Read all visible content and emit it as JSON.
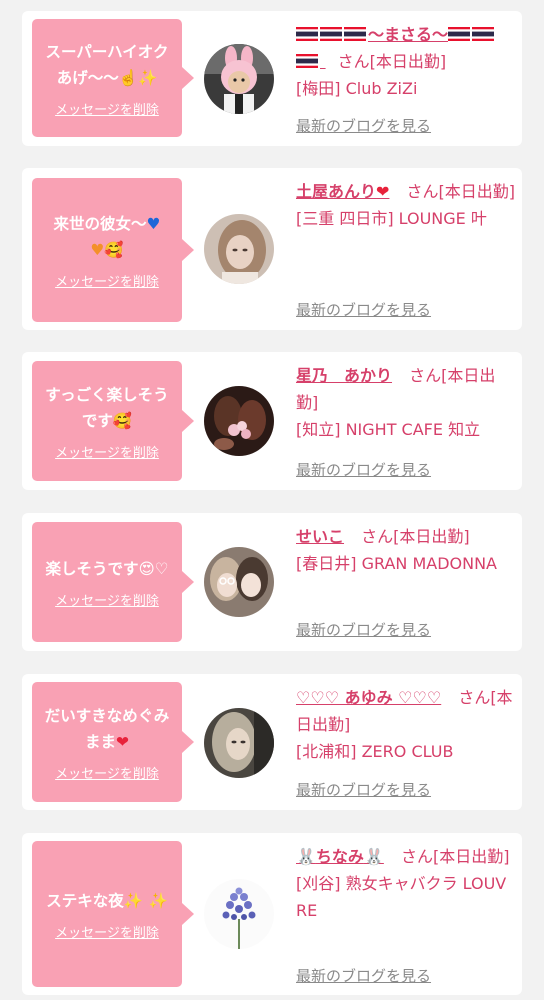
{
  "cards": [
    {
      "message": "スーパーハイオクあげ〜〜☝️✨",
      "delete_label": "メッセージを削除",
      "name": "〜まさる〜",
      "suffix": "さん[本日出勤]",
      "shop": "[梅田] Club ZiZi",
      "blog_label": "最新のブログを見る",
      "avatar_icon": "bunny-hat-person-avatar-icon"
    },
    {
      "message_line1": "来世の彼女〜",
      "message_line2": "🥰",
      "delete_label": "メッセージを削除",
      "name": "土屋あんり",
      "suffix": "さん[本日出勤]",
      "shop": "[三重 四日市] LOUNGE 叶",
      "blog_label": "最新のブログを見る",
      "avatar_icon": "woman-portrait-avatar-icon"
    },
    {
      "message": "すっごく楽しそうです🥰",
      "delete_label": "メッセージを削除",
      "name": "星乃　あかり",
      "suffix": "さん[本日出勤]",
      "shop": "[知立] NIGHT CAFE 知立",
      "blog_label": "最新のブログを見る",
      "avatar_icon": "dark-photo-avatar-icon"
    },
    {
      "message": "楽しそうです😍♡",
      "delete_label": "メッセージを削除",
      "name": "せいこ",
      "suffix": "さん[本日出勤]",
      "shop": "[春日井] GRAN MADONNA",
      "blog_label": "最新のブログを見る",
      "avatar_icon": "two-women-avatar-icon"
    },
    {
      "message_line1": "だいすきなめぐみまま",
      "delete_label": "メッセージを削除",
      "name": "♡♡♡ あゆみ ♡♡♡",
      "suffix": "さん[本日出勤]",
      "shop": "[北浦和] ZERO CLUB",
      "blog_label": "最新のブログを見る",
      "avatar_icon": "blurred-woman-avatar-icon"
    },
    {
      "message": "ステキな夜✨ ✨",
      "delete_label": "メッセージを削除",
      "name": "ちなみ",
      "suffix": "さん[本日出勤]",
      "shop": "[刈谷] 熟女キャバクラ LOUVRE",
      "blog_label": "最新のブログを見る",
      "avatar_icon": "purple-flower-avatar-icon"
    }
  ],
  "colors": {
    "bubble": "#f9a1b4",
    "name": "#d6406a",
    "blog_link": "#8a8a8a",
    "background": "#f2f2f2"
  }
}
